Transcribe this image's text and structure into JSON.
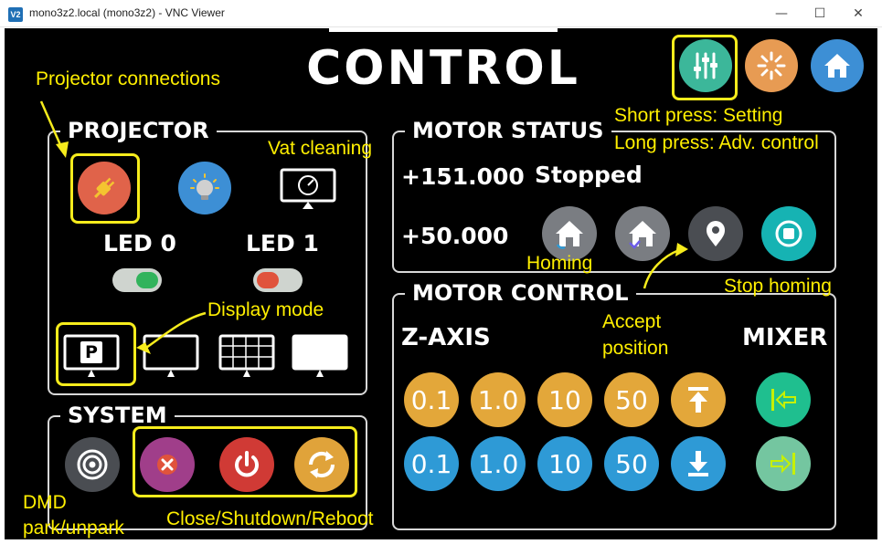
{
  "window": {
    "icon": "V2",
    "title": "mono3z2.local (mono3z2) - VNC Viewer",
    "minimize_icon": "minimize-icon",
    "maximize_icon": "maximize-icon",
    "close_icon": "close-icon"
  },
  "header": {
    "title": "CONTROL",
    "buttons": [
      {
        "name": "settings",
        "icon": "sliders-icon",
        "color": "#3cb79a"
      },
      {
        "name": "busy",
        "icon": "spinner-icon",
        "color": "#e79b53"
      },
      {
        "name": "home",
        "icon": "home-icon",
        "color": "#3d8fd5"
      }
    ]
  },
  "projector": {
    "title": "PROJECTOR",
    "connect_icon": "plug-icon",
    "light_icon": "lightbulb-icon",
    "monitor_icon": "monitor-gauge-icon",
    "led0_label": "LED 0",
    "led1_label": "LED 1",
    "led0_state": "on",
    "led1_state": "off",
    "display_modes": [
      {
        "name": "p",
        "label": "P"
      },
      {
        "name": "blank"
      },
      {
        "name": "grid"
      },
      {
        "name": "white"
      }
    ]
  },
  "system": {
    "title": "SYSTEM",
    "buttons": [
      {
        "name": "dmd",
        "icon": "target-icon",
        "color": "#4a4d52"
      },
      {
        "name": "close",
        "icon": "close-x-icon",
        "color": "#a03e8a"
      },
      {
        "name": "shutdown",
        "icon": "power-icon",
        "color": "#d03a35"
      },
      {
        "name": "reboot",
        "icon": "reboot-icon",
        "color": "#e0a33a"
      }
    ]
  },
  "motor_status": {
    "title": "MOTOR STATUS",
    "z_position": "+151.000",
    "state": "Stopped",
    "mixer_position": "+50.000",
    "buttons": [
      {
        "name": "home-z",
        "icon": "home-icon"
      },
      {
        "name": "home-mixer",
        "icon": "home-check-icon"
      },
      {
        "name": "accept",
        "icon": "location-pin-icon"
      },
      {
        "name": "stop",
        "icon": "stop-icon"
      }
    ]
  },
  "motor_control": {
    "title": "MOTOR CONTROL",
    "z_axis_label": "Z-AXIS",
    "mixer_label": "MIXER",
    "up_steps": [
      "0.1",
      "1.0",
      "10",
      "50"
    ],
    "down_steps": [
      "0.1",
      "1.0",
      "10",
      "50"
    ],
    "up_icon": "arrow-up-bar-icon",
    "down_icon": "arrow-down-bar-icon",
    "mixer_left_icon": "arrow-left-bar-icon",
    "mixer_right_icon": "arrow-right-bar-icon"
  },
  "annotations": {
    "projector_connections": "Projector connections",
    "vat_cleaning": "Vat cleaning",
    "display_mode": "Display mode",
    "short_press": "Short press: Setting",
    "long_press": "Long press: Adv. control",
    "homing": "Homing",
    "stop_homing": "Stop homing",
    "accept_1": "Accept",
    "accept_2": "position",
    "dmd_1": "DMD",
    "dmd_2": "park/unpark",
    "close_shutdown": "Close/Shutdown/Reboot"
  },
  "colors": {
    "annotation": "#ffef00",
    "step_orange": "#e3a73a",
    "step_blue": "#2e9ad6",
    "mixer_green": "#1fbf8f",
    "mixer_light_green": "#74c6a0"
  }
}
